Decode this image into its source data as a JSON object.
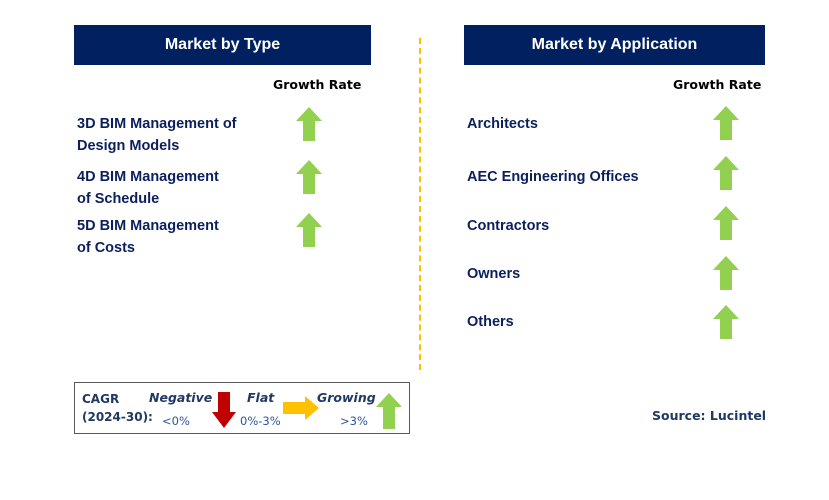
{
  "market_by_type": {
    "title": "Market by Type",
    "growth_header": "Growth Rate",
    "items": [
      {
        "label_line1": "3D BIM Management of",
        "label_line2": "Design Models",
        "trend": "growing"
      },
      {
        "label_line1": "4D BIM Management",
        "label_line2": "of Schedule",
        "trend": "growing"
      },
      {
        "label_line1": "5D BIM Management",
        "label_line2": "of Costs",
        "trend": "growing"
      }
    ]
  },
  "market_by_application": {
    "title": "Market by Application",
    "growth_header": "Growth Rate",
    "items": [
      {
        "label": "Architects",
        "trend": "growing"
      },
      {
        "label": "AEC Engineering Offices",
        "trend": "growing"
      },
      {
        "label": "Contractors",
        "trend": "growing"
      },
      {
        "label": "Owners",
        "trend": "growing"
      },
      {
        "label": "Others",
        "trend": "growing"
      }
    ]
  },
  "legend": {
    "cagr_label": "CAGR",
    "period_label": "(2024-30):",
    "negative": {
      "label": "Negative",
      "range": "<0%",
      "icon": "arrow-down-icon"
    },
    "flat": {
      "label": "Flat",
      "range": "0%-3%",
      "icon": "arrow-right-icon"
    },
    "growing": {
      "label": "Growing",
      "range": ">3%",
      "icon": "arrow-up-icon"
    }
  },
  "source": "Source: Lucintel",
  "colors": {
    "header_bg": "#002060",
    "growing": "#92d050",
    "flat": "#ffc000",
    "negative": "#c00000",
    "divider": "#ffc000",
    "text_navy": "#0b1f5c"
  }
}
